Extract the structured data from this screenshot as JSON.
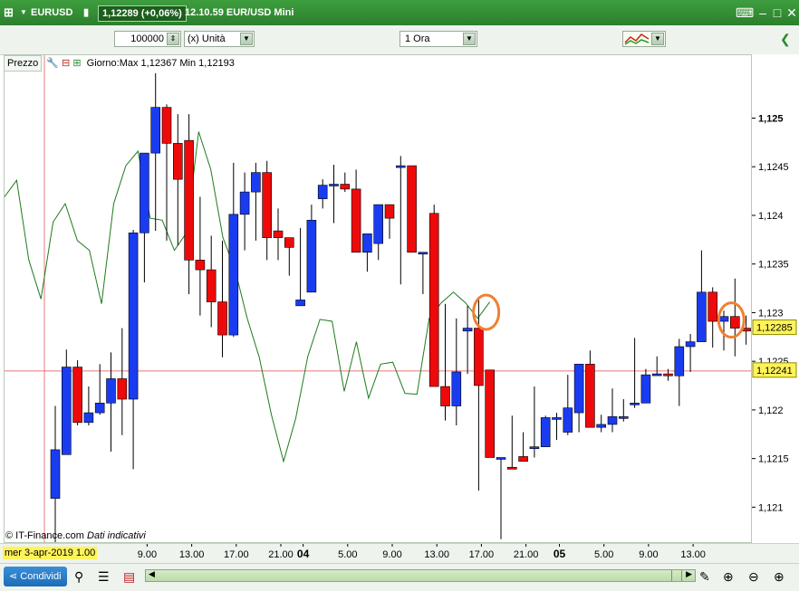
{
  "window": {
    "symbol": "EURUSD",
    "price": "1,12289 (+0,06%)",
    "info": "12.10.59 EUR/USD Mini"
  },
  "toolbar": {
    "quantity": "100000",
    "unit": "(x) Unità",
    "timeframe": "1 Ora"
  },
  "legend": {
    "prezzo": "Prezzo",
    "range": "Giorno:Max 1,12367 Min 1,12193"
  },
  "footer": {
    "copyright": "© IT-Finance.com",
    "note": "Dati indicativi",
    "crosshair_label": "mer 3-apr-2019 1.00",
    "share": "Condividi"
  },
  "price_tags": {
    "last": "1,12285",
    "crosshair": "1,12241"
  },
  "colors": {
    "up": "#1a3cf0",
    "down": "#ee0a0a",
    "line": "#1e7a1e",
    "crosshair": "#e87878",
    "circle": "#f08030",
    "titlebar": "#2f8a2f"
  },
  "chart_data": {
    "type": "candlestick",
    "ylim": [
      1.12065,
      1.12547
    ],
    "y_ticks": [
      "1,125",
      "1,1245",
      "1,124",
      "1,1235",
      "1,123",
      "1,1225",
      "1,122",
      "1,1215",
      "1,121"
    ],
    "y_tick_values": [
      1.125,
      1.1245,
      1.124,
      1.1235,
      1.123,
      1.1225,
      1.122,
      1.1215,
      1.121
    ],
    "x_ticks": [
      {
        "label": "9.00",
        "bar": 8
      },
      {
        "label": "13.00",
        "bar": 12
      },
      {
        "label": "17.00",
        "bar": 16
      },
      {
        "label": "21.00",
        "bar": 20
      },
      {
        "label": "04",
        "bar": 22,
        "bold": true
      },
      {
        "label": "5.00",
        "bar": 26
      },
      {
        "label": "9.00",
        "bar": 30
      },
      {
        "label": "13.00",
        "bar": 34
      },
      {
        "label": "17.00",
        "bar": 38
      },
      {
        "label": "21.00",
        "bar": 42
      },
      {
        "label": "05",
        "bar": 45,
        "bold": true
      },
      {
        "label": "5.00",
        "bar": 49
      },
      {
        "label": "9.00",
        "bar": 53
      },
      {
        "label": "13.00",
        "bar": 57
      }
    ],
    "candles": [
      [
        1.1211,
        1.12205,
        1.12065,
        1.1216
      ],
      [
        1.12155,
        1.12263,
        1.1216,
        1.12245
      ],
      [
        1.12245,
        1.12252,
        1.12185,
        1.12188
      ],
      [
        1.12188,
        1.12225,
        1.12185,
        1.12198
      ],
      [
        1.12198,
        1.12248,
        1.12196,
        1.12208
      ],
      [
        1.12208,
        1.1226,
        1.12158,
        1.12233
      ],
      [
        1.12233,
        1.12285,
        1.12175,
        1.12212
      ],
      [
        1.12212,
        1.12386,
        1.1214,
        1.12383
      ],
      [
        1.12383,
        1.1246,
        1.12332,
        1.12465
      ],
      [
        1.12465,
        1.12547,
        1.12385,
        1.12512
      ],
      [
        1.12512,
        1.12515,
        1.12375,
        1.12475
      ],
      [
        1.12475,
        1.12505,
        1.1237,
        1.12438
      ],
      [
        1.12478,
        1.12505,
        1.1232,
        1.12355
      ],
      [
        1.12355,
        1.1242,
        1.12298,
        1.12345
      ],
      [
        1.12345,
        1.1238,
        1.12286,
        1.12312
      ],
      [
        1.12312,
        1.12375,
        1.12255,
        1.12278
      ],
      [
        1.12278,
        1.12455,
        1.12276,
        1.12402
      ],
      [
        1.12402,
        1.12445,
        1.12365,
        1.12425
      ],
      [
        1.12425,
        1.12455,
        1.12375,
        1.12445
      ],
      [
        1.12445,
        1.12457,
        1.12355,
        1.12378
      ],
      [
        1.12385,
        1.12408,
        1.12355,
        1.12378
      ],
      [
        1.12378,
        1.12368,
        1.12339,
        1.12368
      ],
      [
        1.12308,
        1.12388,
        1.12308,
        1.12314
      ],
      [
        1.12322,
        1.12412,
        1.12322,
        1.12396
      ],
      [
        1.12418,
        1.12438,
        1.12408,
        1.12432
      ],
      [
        1.12433,
        1.12453,
        1.12393,
        1.12433
      ],
      [
        1.12433,
        1.12445,
        1.12425,
        1.12428
      ],
      [
        1.12428,
        1.12448,
        1.12365,
        1.12363
      ],
      [
        1.12363,
        1.1237,
        1.12343,
        1.12382
      ],
      [
        1.12372,
        1.12408,
        1.12355,
        1.12412
      ],
      [
        1.12412,
        1.12405,
        1.12377,
        1.12398
      ],
      [
        1.12452,
        1.12462,
        1.1233,
        1.12452
      ],
      [
        1.12452,
        1.12443,
        1.12375,
        1.12363
      ],
      [
        1.12363,
        1.12362,
        1.1232,
        1.12363
      ],
      [
        1.12403,
        1.12412,
        1.1227,
        1.12225
      ],
      [
        1.12225,
        1.1231,
        1.1219,
        1.12205
      ],
      [
        1.12205,
        1.12295,
        1.12185,
        1.1224
      ],
      [
        1.12282,
        1.12308,
        1.12238,
        1.12285
      ],
      [
        1.12285,
        1.12315,
        1.12118,
        1.12226
      ],
      [
        1.12242,
        1.12233,
        1.12165,
        1.12152
      ],
      [
        1.12152,
        1.12126,
        1.12068,
        1.12152
      ],
      [
        1.12142,
        1.12195,
        1.1215,
        1.1214
      ],
      [
        1.12153,
        1.12178,
        1.12148,
        1.12148
      ],
      [
        1.12163,
        1.12225,
        1.12152,
        1.12163
      ],
      [
        1.12163,
        1.12195,
        1.12178,
        1.12193
      ],
      [
        1.12193,
        1.12198,
        1.1217,
        1.12193
      ],
      [
        1.12178,
        1.12237,
        1.12175,
        1.12203
      ],
      [
        1.12198,
        1.12242,
        1.12178,
        1.12248
      ],
      [
        1.12248,
        1.12262,
        1.12195,
        1.12183
      ],
      [
        1.12183,
        1.12196,
        1.12178,
        1.12186
      ],
      [
        1.12186,
        1.12223,
        1.12178,
        1.12194
      ],
      [
        1.12194,
        1.12212,
        1.12189,
        1.12194
      ],
      [
        1.12207,
        1.12275,
        1.12203,
        1.12208
      ],
      [
        1.12208,
        1.12243,
        1.12225,
        1.12237
      ],
      [
        1.12237,
        1.12256,
        1.12239,
        1.12238
      ],
      [
        1.12238,
        1.12243,
        1.12231,
        1.12236
      ],
      [
        1.12236,
        1.12274,
        1.12205,
        1.12266
      ],
      [
        1.12266,
        1.12279,
        1.1224,
        1.12271
      ],
      [
        1.12271,
        1.12365,
        1.12335,
        1.12322
      ],
      [
        1.12322,
        1.12327,
        1.12265,
        1.12292
      ],
      [
        1.12292,
        1.12303,
        1.12262,
        1.12297
      ],
      [
        1.12297,
        1.12336,
        1.12256,
        1.12285
      ],
      [
        1.12285,
        1.12298,
        1.12268,
        1.12282
      ]
    ],
    "overlay_line": {
      "color": "#1e7a1e",
      "values": [
        1.1242,
        1.12437,
        1.12355,
        1.12315,
        1.12394,
        1.12413,
        1.12375,
        1.12365,
        1.1231,
        1.12413,
        1.12452,
        1.12467,
        1.12398,
        1.12396,
        1.12365,
        1.12383,
        1.12487,
        1.12448,
        1.12378,
        1.12345,
        1.12295,
        1.12255,
        1.12196,
        1.12148,
        1.12192,
        1.12256,
        1.12294,
        1.12292,
        1.1222,
        1.12271,
        1.12213,
        1.12248,
        1.1225,
        1.12218,
        1.12217,
        1.12295,
        1.12311,
        1.12322,
        1.12311,
        1.12295,
        1.12312
      ]
    },
    "annotations": [
      {
        "type": "circle",
        "bar": 39,
        "y": 1.12293
      },
      {
        "type": "circle",
        "bar": 61,
        "y": 1.12285
      }
    ],
    "crosshair": {
      "bar": 0,
      "y": 1.12241
    }
  }
}
